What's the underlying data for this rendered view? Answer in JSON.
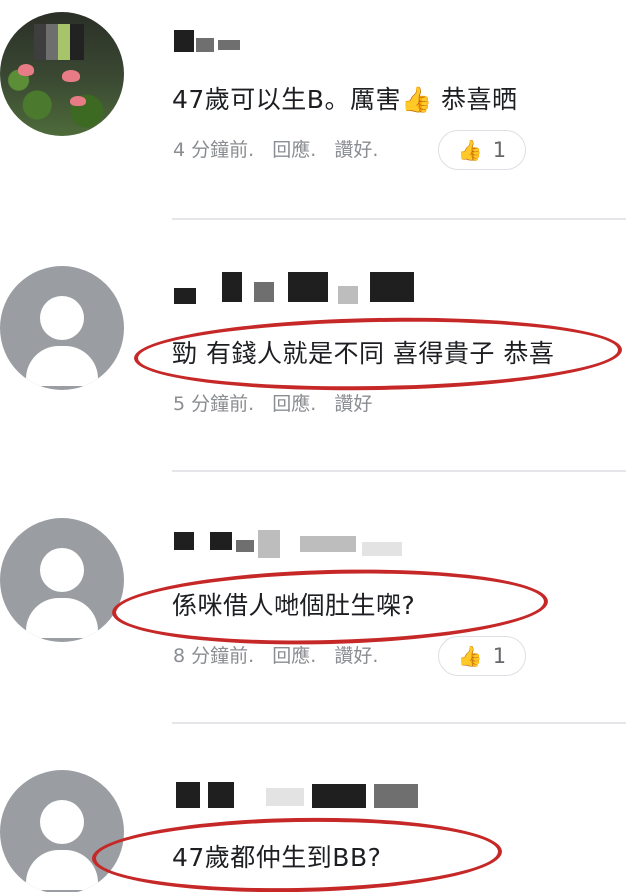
{
  "comments": [
    {
      "avatar_type": "photo",
      "text": "47歲可以生B。厲害👍 恭喜晒",
      "time": "4 分鐘前.",
      "reply": "回應.",
      "like": "讚好.",
      "reaction_count": "1",
      "reaction_icon": "thumbs-up-icon",
      "circled": false
    },
    {
      "avatar_type": "default",
      "text": "勁 有錢人就是不同 喜得貴子 恭喜",
      "time": "5 分鐘前.",
      "reply": "回應.",
      "like": "讚好",
      "circled": true
    },
    {
      "avatar_type": "default",
      "text": "係咪借人哋個肚生㗎?",
      "time": "8 分鐘前.",
      "reply": "回應.",
      "like": "讚好.",
      "reaction_count": "1",
      "reaction_icon": "thumbs-up-icon",
      "circled": true
    },
    {
      "avatar_type": "default",
      "text": "47歲都仲生到BB?",
      "circled": true
    }
  ],
  "colors": {
    "annotation": "#c62828",
    "meta_text": "#8a8d91",
    "divider": "#e4e6ea",
    "avatar_default": "#9a9ea3"
  }
}
